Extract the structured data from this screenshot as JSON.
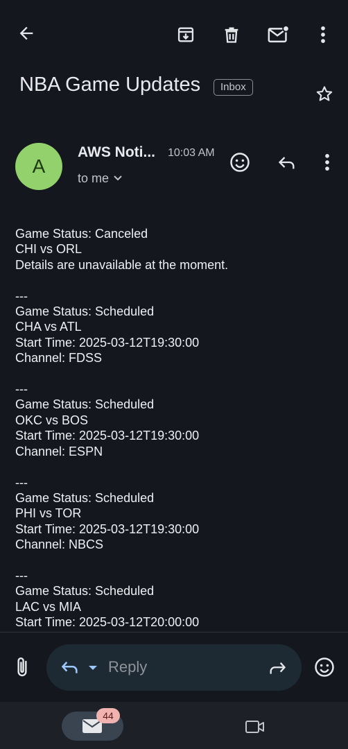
{
  "toolbar": {
    "back": "back-arrow-icon",
    "archive": "archive-icon",
    "delete": "trash-icon",
    "unread": "mark-unread-icon",
    "more": "more-vert-icon"
  },
  "email": {
    "subject": "NBA Game Updates",
    "label": "Inbox",
    "sender_initial": "A",
    "sender_name": "AWS Noti...",
    "time": "10:03 AM",
    "recipient": "to me",
    "body": "Game Status: Canceled\nCHI vs ORL\nDetails are unavailable at the moment.\n\n---\nGame Status: Scheduled\nCHA vs ATL\nStart Time: 2025-03-12T19:30:00\nChannel: FDSS\n\n---\nGame Status: Scheduled\nOKC vs BOS\nStart Time: 2025-03-12T19:30:00\nChannel: ESPN\n\n---\nGame Status: Scheduled\nPHI vs TOR\nStart Time: 2025-03-12T19:30:00\nChannel: NBCS\n\n---\nGame Status: Scheduled\nLAC vs MIA\nStart Time: 2025-03-12T20:00:00"
  },
  "reply_bar": {
    "placeholder": "Reply"
  },
  "nav": {
    "mail_badge": "44"
  },
  "colors": {
    "background": "#15171e",
    "avatar": "#92d16b",
    "badge": "#f1b3b0",
    "reply_pill": "#1e2a33"
  }
}
